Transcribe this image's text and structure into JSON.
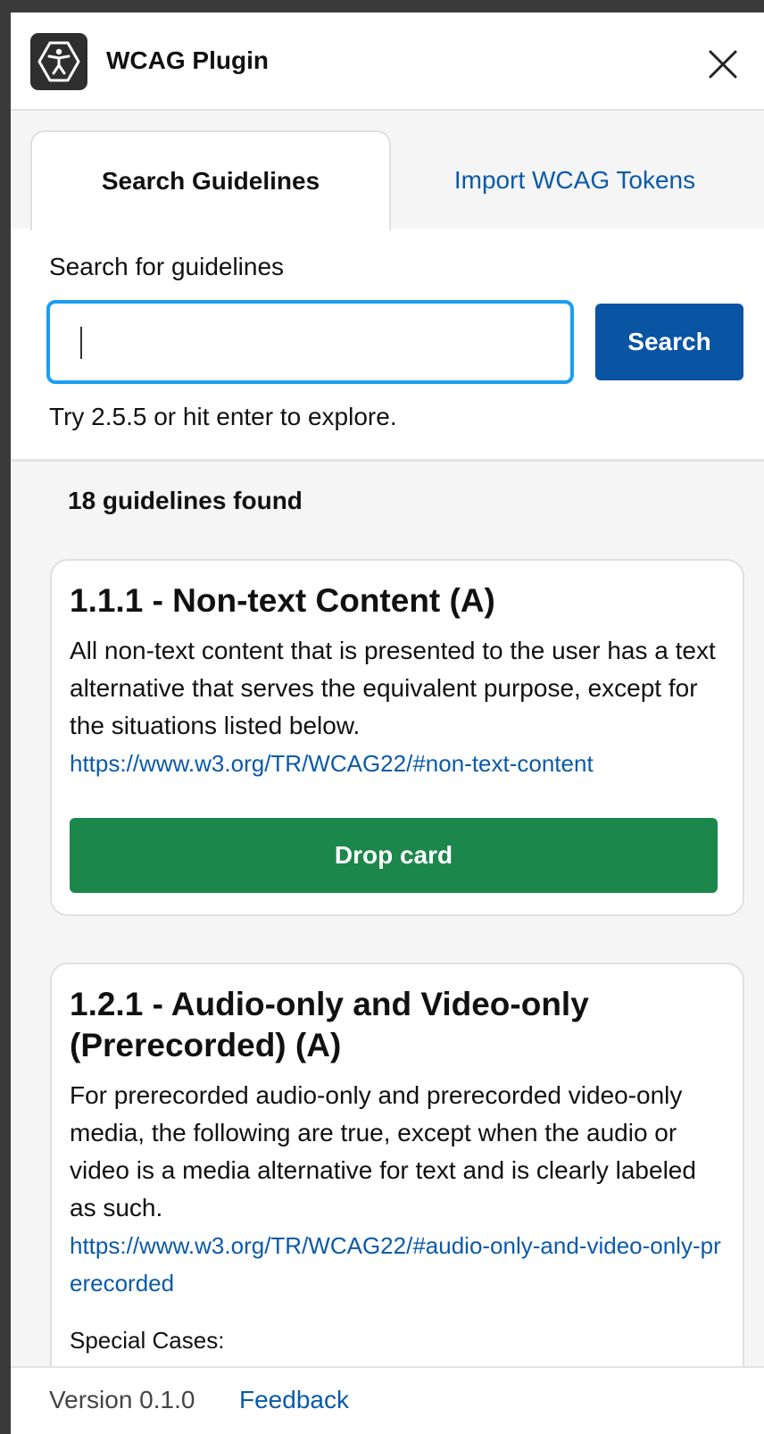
{
  "header": {
    "title": "WCAG Plugin",
    "logo_icon": "accessibility-icon",
    "close_icon": "close-icon"
  },
  "tabs": [
    {
      "label": "Search Guidelines",
      "active": true
    },
    {
      "label": "Import WCAG Tokens",
      "active": false
    }
  ],
  "search": {
    "label": "Search for guidelines",
    "value": "",
    "button_label": "Search",
    "hint": "Try 2.5.5 or hit enter to explore."
  },
  "results": {
    "count_text": "18 guidelines found",
    "cards": [
      {
        "title": "1.1.1 - Non-text Content (A)",
        "description": "All non-text content that is presented to the user has a text alternative that serves the equivalent purpose, except for the situations listed below.",
        "link": "https://www.w3.org/TR/WCAG22/#non-text-content",
        "button_label": "Drop card"
      },
      {
        "title": "1.2.1 - Audio-only and Video-only (Prerecorded) (A)",
        "description": "For prerecorded audio-only and prerecorded video-only media, the following are true, except when the audio or video is a media alternative for text and is clearly labeled as such.",
        "link": "https://www.w3.org/TR/WCAG22/#audio-only-and-video-only-prerecorded",
        "special_label": "Special Cases:"
      }
    ]
  },
  "footer": {
    "version": "Version 0.1.0",
    "feedback": "Feedback"
  },
  "colors": {
    "primary": "#0a54a4",
    "link": "#0a5aa8",
    "success": "#1b874b",
    "focus": "#1b9ef0"
  }
}
